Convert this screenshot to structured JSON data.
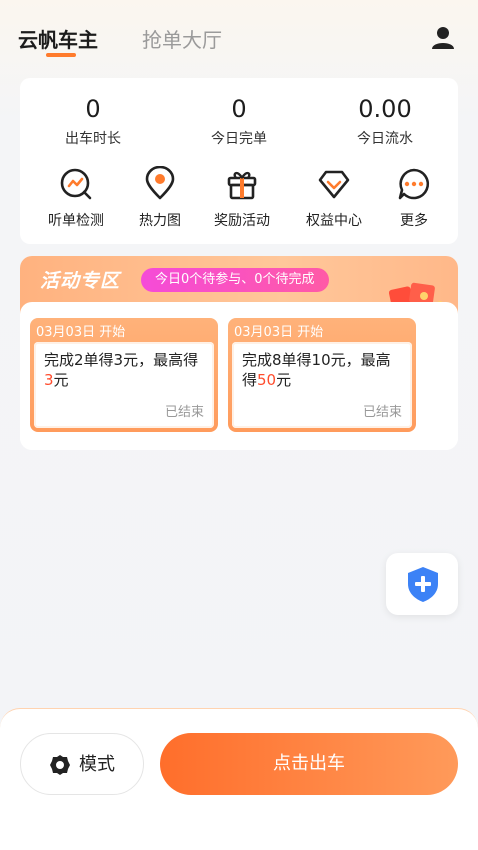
{
  "header": {
    "tabs": [
      {
        "label": "云帆车主",
        "active": true
      },
      {
        "label": "抢单大厅",
        "active": false
      }
    ],
    "user_icon": "user-icon"
  },
  "stats": [
    {
      "value": "0",
      "label": "出车时长"
    },
    {
      "value": "0",
      "label": "今日完单"
    },
    {
      "value": "0.00",
      "label": "今日流水"
    }
  ],
  "tools": [
    {
      "label": "听单检测",
      "icon": "listen-check-icon"
    },
    {
      "label": "热力图",
      "icon": "heatmap-pin-icon"
    },
    {
      "label": "奖励活动",
      "icon": "gift-icon"
    },
    {
      "label": "权益中心",
      "icon": "diamond-heart-icon"
    },
    {
      "label": "更多",
      "icon": "more-dots-icon"
    }
  ],
  "activity": {
    "title": "活动专区",
    "summary": "今日0个待参与、0个待完成",
    "coupons": [
      {
        "date": "03月03日 开始",
        "text_prefix": "完成2单得3元，最高得",
        "text_highlight": "3",
        "text_suffix": "元",
        "status": "已结束"
      },
      {
        "date": "03月03日 开始",
        "text_prefix": "完成8单得10元，最高得",
        "text_highlight": "50",
        "text_suffix": "元",
        "status": "已结束"
      }
    ]
  },
  "floating": {
    "icon": "shield-plus-icon"
  },
  "bottom_bar": {
    "mode_label": "模式",
    "start_label": "点击出车"
  },
  "colors": {
    "accent": "#ff7b2c",
    "highlight_red": "#ff4d2e",
    "pill_pink": "#f54bd8",
    "shield_blue": "#3c82f6"
  }
}
